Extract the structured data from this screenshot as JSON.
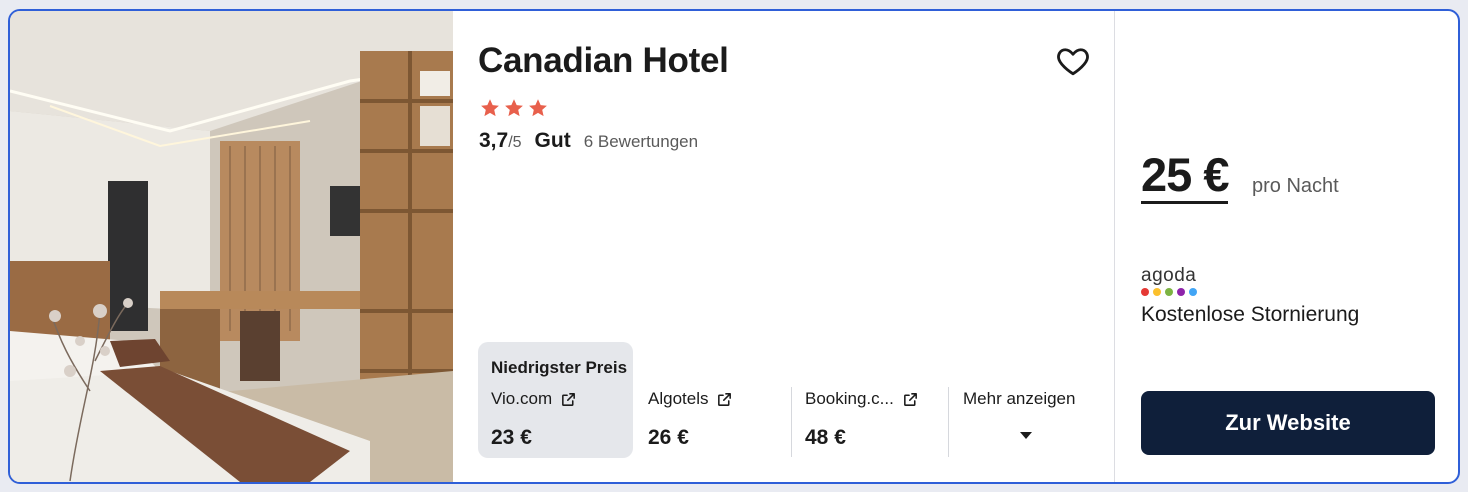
{
  "hotel": {
    "name": "Canadian Hotel",
    "star_count": 3,
    "score": "3,7",
    "score_max": "/5",
    "rating_word": "Gut",
    "review_count": "6 Bewertungen"
  },
  "offers": {
    "best_label": "Niedrigster Preis",
    "items": [
      {
        "provider": "Vio.com",
        "price": "23 €"
      },
      {
        "provider": "Algotels",
        "price": "26 €"
      },
      {
        "provider": "Booking.c...",
        "price": "48 €"
      }
    ],
    "more_label": "Mehr anzeigen"
  },
  "deal": {
    "price": "25 €",
    "per_night": "pro Nacht",
    "provider_logo": "agoda",
    "provider_dot_colors": [
      "#e53935",
      "#fbc02d",
      "#7cb342",
      "#8e24aa",
      "#42a5f5"
    ],
    "cancellation": "Kostenlose Stornierung",
    "cta_label": "Zur Website"
  },
  "colors": {
    "accent_border": "#2f5fd8",
    "star": "#e8604c",
    "cta_bg": "#0f1f3a"
  },
  "icons": {
    "favorite": "heart-outline-icon",
    "external": "external-link-icon",
    "more": "caret-down-icon"
  }
}
